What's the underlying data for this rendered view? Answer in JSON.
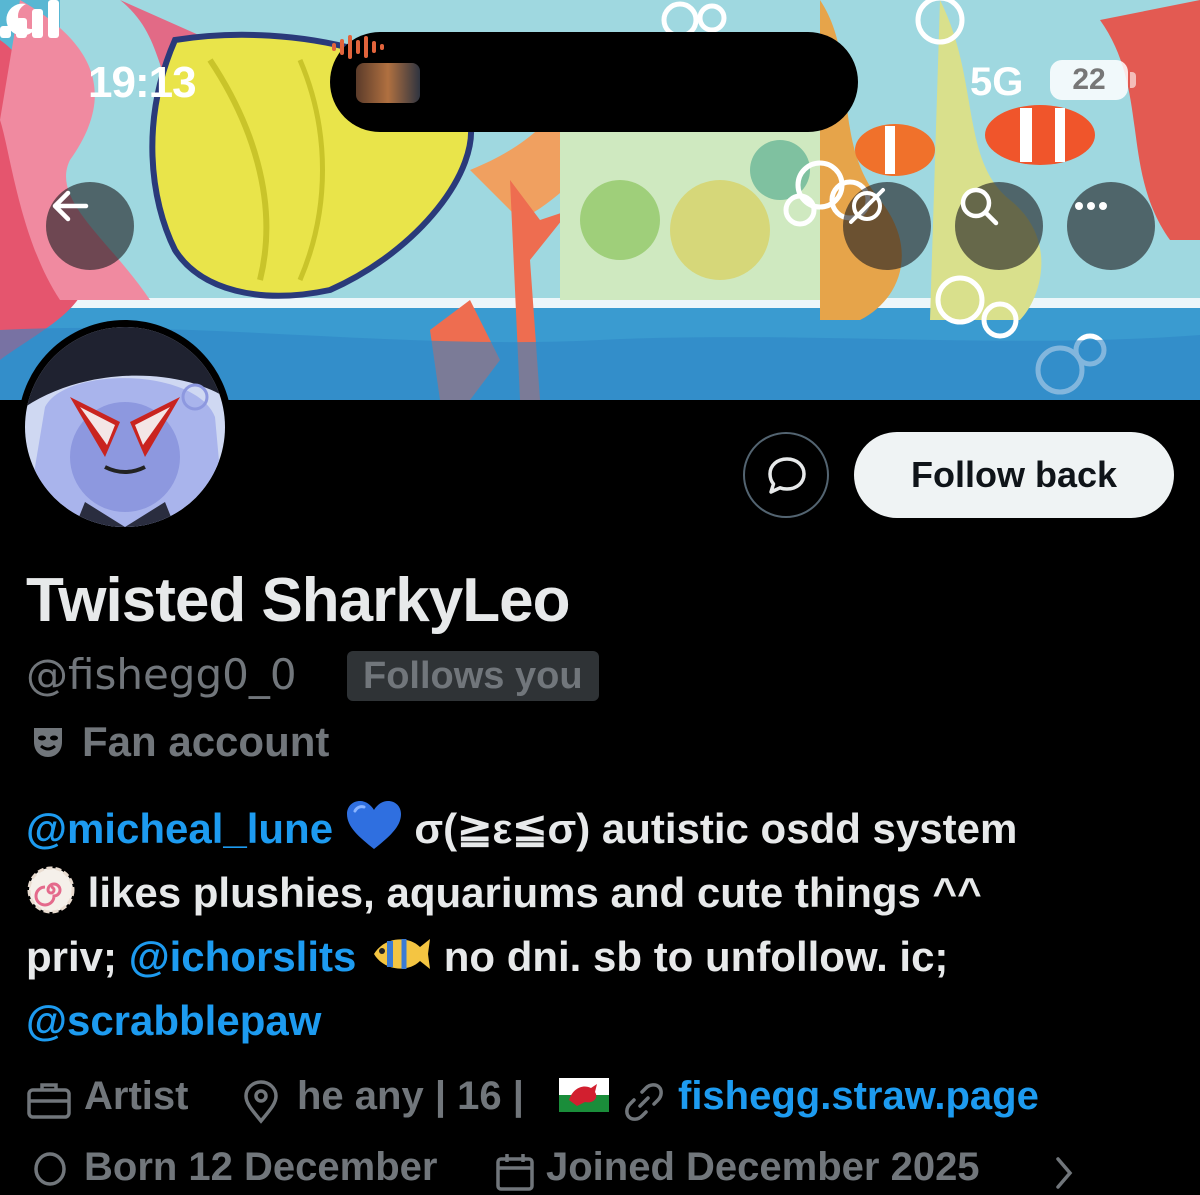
{
  "status_bar": {
    "time": "19:13",
    "network": "5G",
    "battery": "22"
  },
  "banner_buttons": {
    "back": "back-arrow",
    "grok": "grok-icon",
    "search": "search-icon",
    "more": "more-icon"
  },
  "actions": {
    "follow_back_label": "Follow back"
  },
  "profile": {
    "display_name": "Twisted SharkyLeo",
    "handle": "@fishegg0_0",
    "follows_you": "Follows you",
    "category": "Fan account",
    "bio": {
      "line1_mention": "@micheal_lune",
      "line1_text": "σ(≧ε≦σ) autistic osdd system",
      "line2_text": "likes plushies, aquariums and cute things ^^",
      "line3_prefix": "priv;",
      "line3_mention": "@ichorslits",
      "line3_text": "no dni. sb to unfollow. ic;",
      "line4_mention": "@scrabblepaw"
    },
    "profession": "Artist",
    "location": "he any | 16 |",
    "website": "fishegg.straw.page",
    "birthday": "Born 12 December",
    "joined": "Joined December 2025"
  },
  "colors": {
    "accent": "#1d9bf0",
    "muted": "#71767b",
    "text": "#e7e9ea",
    "background": "#000000"
  }
}
